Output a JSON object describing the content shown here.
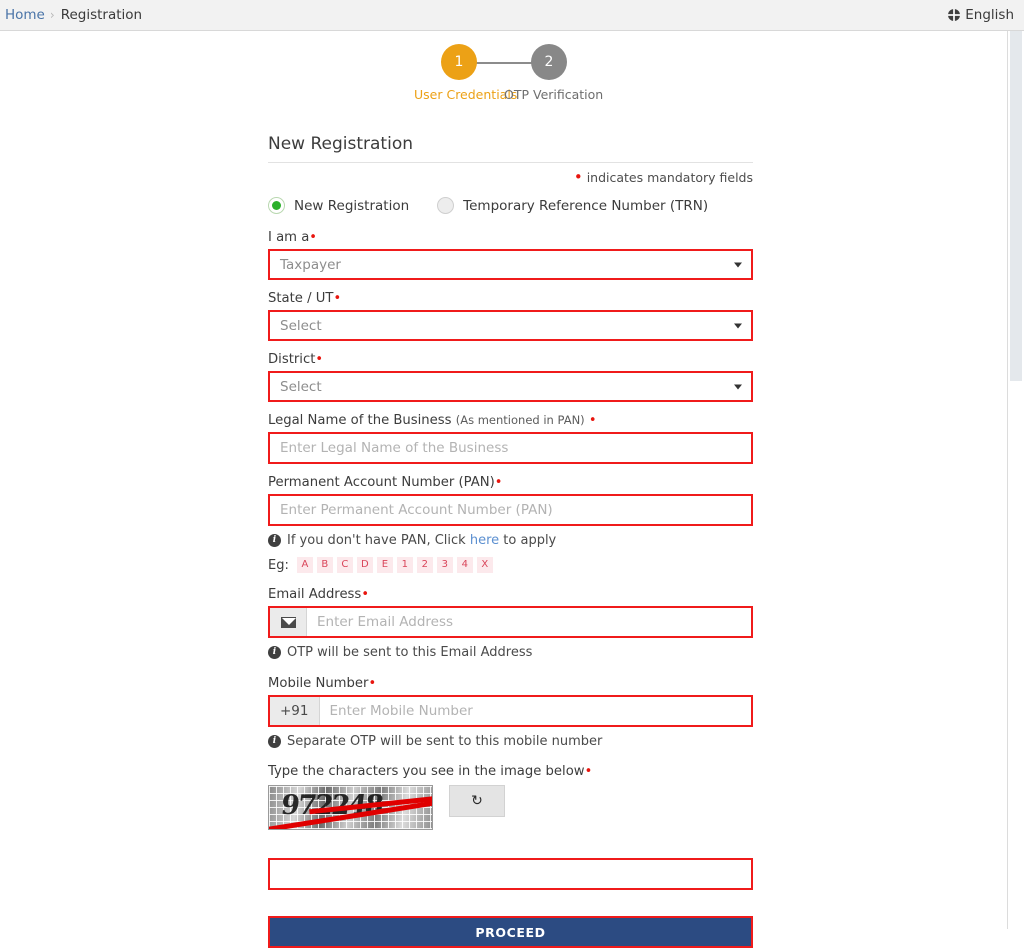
{
  "topbar": {
    "breadcrumb_home": "Home",
    "breadcrumb_sep": "›",
    "breadcrumb_current": "Registration",
    "language": "English",
    "globe_icon": "globe-icon"
  },
  "stepper": {
    "steps": [
      {
        "number": "1",
        "label": "User Credentials",
        "state": "active"
      },
      {
        "number": "2",
        "label": "OTP Verification",
        "state": "inactive"
      }
    ]
  },
  "form": {
    "title": "New Registration",
    "mandatory_note": "indicates mandatory fields",
    "mandatory_marker": "•",
    "radio_options": [
      {
        "label": "New Registration",
        "checked": true
      },
      {
        "label": "Temporary Reference Number (TRN)",
        "checked": false
      }
    ],
    "fields": {
      "i_am_a": {
        "label": "I am a",
        "value": "Taxpayer",
        "type": "select",
        "required": true
      },
      "state_ut": {
        "label": "State / UT",
        "value": "Select",
        "type": "select",
        "required": true
      },
      "district": {
        "label": "District",
        "value": "Select",
        "type": "select",
        "required": true
      },
      "legal_name": {
        "label": "Legal Name of the Business",
        "sublabel": "(As mentioned in PAN)",
        "placeholder": "Enter Legal Name of the Business",
        "value": "",
        "required": true
      },
      "pan": {
        "label": "Permanent Account Number (PAN)",
        "placeholder": "Enter Permanent Account Number (PAN)",
        "value": "",
        "required": true,
        "hint_prefix": "If you don't have PAN, Click",
        "hint_link": "here",
        "hint_suffix": "to apply",
        "eg_label": "Eg:",
        "eg_chars": [
          "A",
          "B",
          "C",
          "D",
          "E",
          "1",
          "2",
          "3",
          "4",
          "X"
        ]
      },
      "email": {
        "label": "Email Address",
        "placeholder": "Enter Email Address",
        "value": "",
        "required": true,
        "prefix_icon": "envelope-icon",
        "hint": "OTP will be sent to this Email Address"
      },
      "mobile": {
        "label": "Mobile Number",
        "placeholder": "Enter Mobile Number",
        "value": "",
        "required": true,
        "country_code": "+91",
        "hint": "Separate OTP will be sent to this mobile number"
      },
      "captcha": {
        "label": "Type the characters you see in the image below",
        "required": true,
        "image_text": "972248",
        "refresh_icon": "refresh-icon",
        "refresh_glyph": "↺",
        "value": "",
        "placeholder": ""
      }
    },
    "proceed_label": "PROCEED"
  },
  "colors": {
    "error_border": "#f01b1b",
    "proceed_bg": "#2c4b82",
    "step_active": "#eca116",
    "step_inactive": "#888888",
    "radio_selected": "#2bb02b",
    "link": "#5b8fd0",
    "breadcrumb_link": "#4a74a8"
  }
}
